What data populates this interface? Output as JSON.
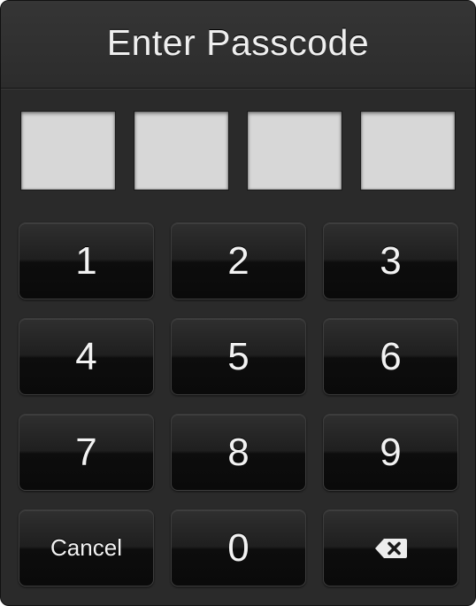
{
  "dialog": {
    "title": "Enter Passcode"
  },
  "passcode": {
    "length": 4,
    "entered": 0
  },
  "keypad": {
    "keys": [
      "1",
      "2",
      "3",
      "4",
      "5",
      "6",
      "7",
      "8",
      "9",
      "0"
    ],
    "cancel_label": "Cancel",
    "delete_icon": "backspace-icon"
  },
  "colors": {
    "background": "#2a2a2a",
    "digit_box": "#d7d7d7",
    "key_text": "#f2f2f2"
  }
}
